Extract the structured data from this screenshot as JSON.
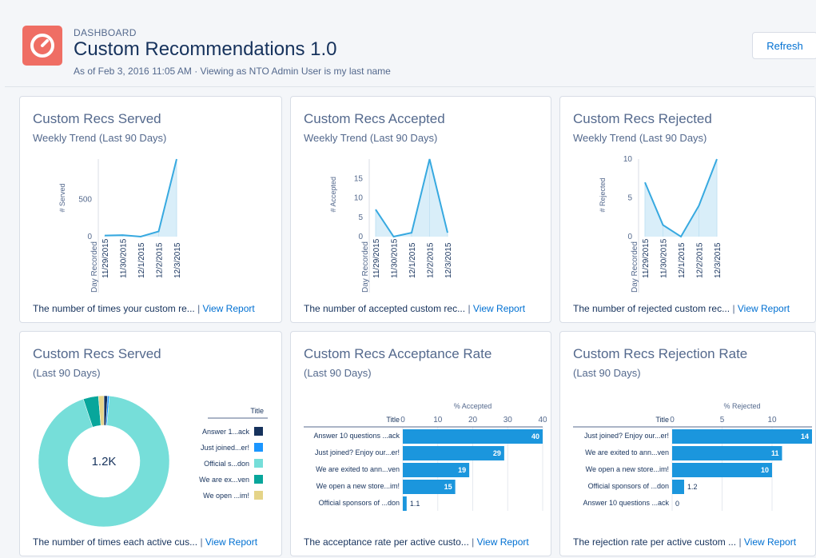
{
  "header": {
    "breadcrumb": "DASHBOARD",
    "title": "Custom Recommendations 1.0",
    "subtitle": "As of Feb 3, 2016 11:05 AM · Viewing as NTO Admin User is my last name",
    "refresh_label": "Refresh",
    "logo_icon": "dashboard-gauge-icon",
    "logo_color": "#ef6e64"
  },
  "cards": [
    {
      "title": "Custom Recs Served",
      "subtitle": "Weekly Trend (Last 90 Days)",
      "footer": "The number of times your custom re...",
      "link": "View Report"
    },
    {
      "title": "Custom Recs Accepted",
      "subtitle": "Weekly Trend (Last 90 Days)",
      "footer": "The number of accepted custom rec...",
      "link": "View Report"
    },
    {
      "title": "Custom Recs Rejected",
      "subtitle": "Weekly Trend (Last 90 Days)",
      "footer": "The number of rejected custom rec...",
      "link": "View Report"
    },
    {
      "title": "Custom Recs Served",
      "subtitle": "(Last 90 Days)",
      "footer": "The number of times each active cus...",
      "link": "View Report"
    },
    {
      "title": "Custom Recs Acceptance Rate",
      "subtitle": "(Last 90 Days)",
      "footer": "The acceptance rate per active custo...",
      "link": "View Report"
    },
    {
      "title": "Custom Recs Rejection Rate",
      "subtitle": "(Last 90 Days)",
      "footer": "The rejection rate per active custom ...",
      "link": "View Report"
    }
  ],
  "chart_data": [
    {
      "type": "area",
      "xlabel": "Day Recorded",
      "ylabel": "# Served",
      "categories": [
        "11/29/2015",
        "11/30/2015",
        "12/1/2015",
        "12/2/2015",
        "12/3/2015"
      ],
      "x_positions": [
        0,
        1,
        2,
        3,
        4
      ],
      "values": [
        15,
        20,
        0,
        70,
        1040
      ],
      "yticks": [
        0,
        500
      ],
      "ylim": [
        0,
        1040
      ],
      "color": "#37a9e0"
    },
    {
      "type": "area",
      "xlabel": "Day Recorded",
      "ylabel": "# Accepted",
      "categories": [
        "11/29/2015",
        "11/30/2015",
        "12/1/2015",
        "12/2/2015",
        "12/3/2015"
      ],
      "values": [
        7,
        0,
        1,
        20,
        1
      ],
      "yticks": [
        0,
        5,
        10,
        15
      ],
      "ylim": [
        0,
        20
      ],
      "color": "#37a9e0"
    },
    {
      "type": "area",
      "xlabel": "Day Recorded",
      "ylabel": "# Rejected",
      "categories": [
        "11/29/2015",
        "11/30/2015",
        "12/1/2015",
        "12/2/2015",
        "12/3/2015"
      ],
      "values": [
        7,
        1.5,
        0,
        4,
        10
      ],
      "yticks": [
        0,
        5,
        10
      ],
      "ylim": [
        0,
        10
      ],
      "color": "#37a9e0"
    },
    {
      "type": "pie",
      "center_label": "1.2K",
      "legend_title": "Title",
      "slices": [
        {
          "label": "Answer 1...ack",
          "value": 10,
          "color": "#16325c"
        },
        {
          "label": "Just joined...er!",
          "value": 5,
          "color": "#1b96ff"
        },
        {
          "label": "Official s...don",
          "value": 1050,
          "color": "#76ded9"
        },
        {
          "label": "We are ex...ven",
          "value": 42,
          "color": "#08a69b"
        },
        {
          "label": "We open ...im!",
          "value": 15,
          "color": "#e5d488"
        }
      ]
    },
    {
      "type": "bar",
      "orientation": "horizontal",
      "xlabel": "% Accepted",
      "category_axis_title": "Title",
      "categories": [
        "Answer 10 questions ...ack",
        "Just joined? Enjoy our...er!",
        "We are exited to ann...ven",
        "We open a new store...im!",
        "Official sponsors of ...don"
      ],
      "values": [
        40,
        29,
        19,
        15,
        1.1
      ],
      "xticks": [
        0,
        10,
        20,
        30,
        40
      ],
      "xlim": [
        0,
        40
      ],
      "color": "#1b96dd"
    },
    {
      "type": "bar",
      "orientation": "horizontal",
      "xlabel": "% Rejected",
      "category_axis_title": "Title",
      "categories": [
        "Just joined? Enjoy our...er!",
        "We are exited to ann...ven",
        "We open a new store...im!",
        "Official sponsors of ...don",
        "Answer 10 questions ...ack"
      ],
      "values": [
        14,
        11,
        10,
        1.2,
        0
      ],
      "xticks": [
        0,
        5,
        10
      ],
      "xlim": [
        0,
        14
      ],
      "color": "#1b96dd"
    }
  ]
}
